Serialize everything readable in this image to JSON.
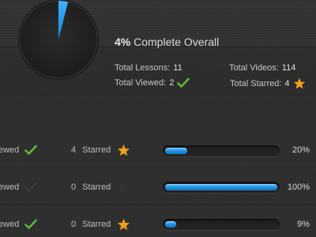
{
  "summary": {
    "overall_percent": 4,
    "overall_percent_label": "4%",
    "overall_text": "Complete Overall",
    "total_lessons_label": "Total Lessons:",
    "total_lessons_value": "11",
    "total_videos_label": "Total Videos:",
    "total_videos_value": "114",
    "total_viewed_label": "Total Viewed:",
    "total_viewed_value": "2",
    "total_starred_label": "Total Starred:",
    "total_starred_value": "4"
  },
  "rows": [
    {
      "viewed_label": "ewed",
      "viewed_checked": true,
      "starred_count": "4",
      "starred_label": "Starred",
      "starred_active": true,
      "progress": 0.2,
      "progress_label": "20%"
    },
    {
      "viewed_label": "ewed",
      "viewed_checked": false,
      "starred_count": "0",
      "starred_label": "Starred",
      "starred_active": false,
      "progress": 1.0,
      "progress_label": "100%"
    },
    {
      "viewed_label": "ewed",
      "viewed_checked": true,
      "starred_count": "0",
      "starred_label": "Starred",
      "starred_active": true,
      "progress": 0.09,
      "progress_label": "9%"
    }
  ],
  "colors": {
    "accent_blue": "#1a8fe0",
    "check_green": "#5db836",
    "check_inactive": "#3a3a3a",
    "star_gold": "#f0a01a",
    "star_inactive": "#333333"
  },
  "icons": {
    "check": "check-icon",
    "star": "star-icon",
    "pie": "progress-pie-icon"
  }
}
